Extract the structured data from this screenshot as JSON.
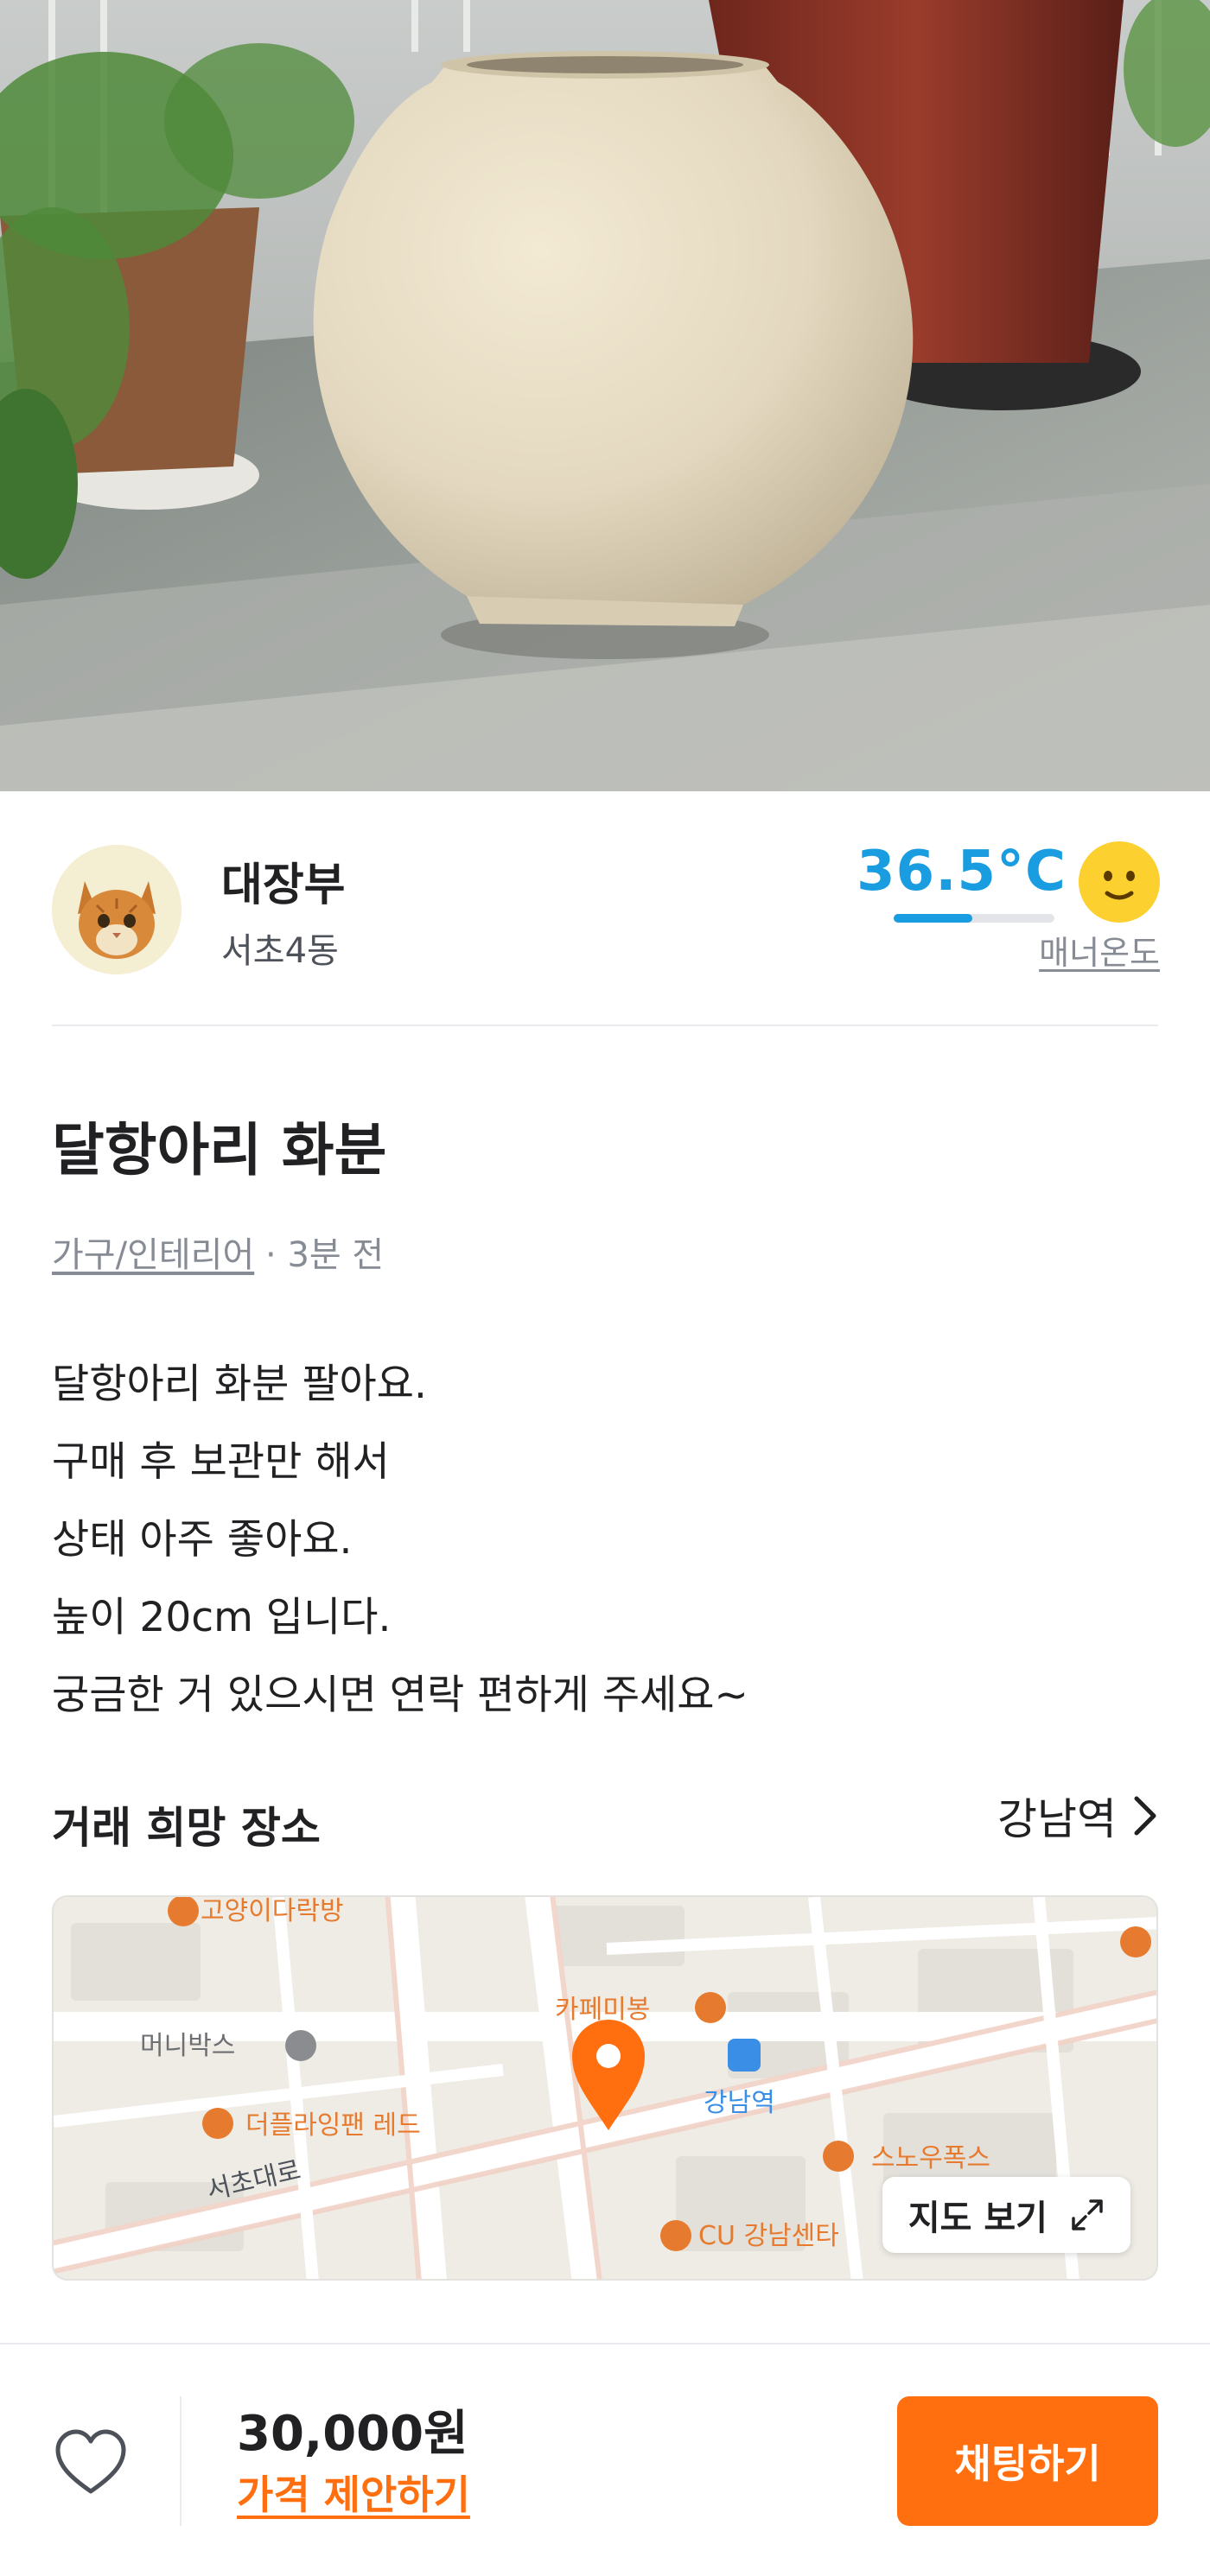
{
  "seller": {
    "nickname": "대장부",
    "region": "서초4동",
    "manner_temperature": "36.5°C",
    "manner_temperature_value": 36.5,
    "manner_label": "매너온도",
    "temp_level": 0.49
  },
  "post": {
    "title": "달항아리 화분",
    "category": "가구/인테리어",
    "time_separator": " · ",
    "time_ago": "3분 전",
    "description": [
      "달항아리 화분 팔아요.",
      "구매 후 보관만 해서",
      "상태 아주 좋아요.",
      "높이 20cm 입니다.",
      "궁금한 거 있으시면 연락 편하게 주세요~"
    ]
  },
  "place": {
    "label": "거래 희망 장소",
    "name": "강남역",
    "view_map_label": "지도 보기",
    "map_labels": {
      "cat_cafe": "고양이다락방",
      "cafe_mibong": "카페미봉",
      "money_box": "머니박스",
      "station": "강남역",
      "red_cafe": "더플라잉팬 레드",
      "road": "서초대로",
      "snow_fox": "스노우폭스",
      "cu_store": "CU 강남센타"
    }
  },
  "bottom_bar": {
    "price": "30,000원",
    "offer_label": "가격 제안하기",
    "chat_label": "채팅하기"
  },
  "colors": {
    "accent": "#ff6f0f",
    "temperature": "#1a9de0",
    "text_primary": "#212124",
    "text_secondary": "#868b94"
  },
  "icons": {
    "like": "heart-outline-icon",
    "chevron": "chevron-right-icon",
    "expand": "expand-icon",
    "pin": "location-pin-icon",
    "manner": "smile-face-icon"
  }
}
